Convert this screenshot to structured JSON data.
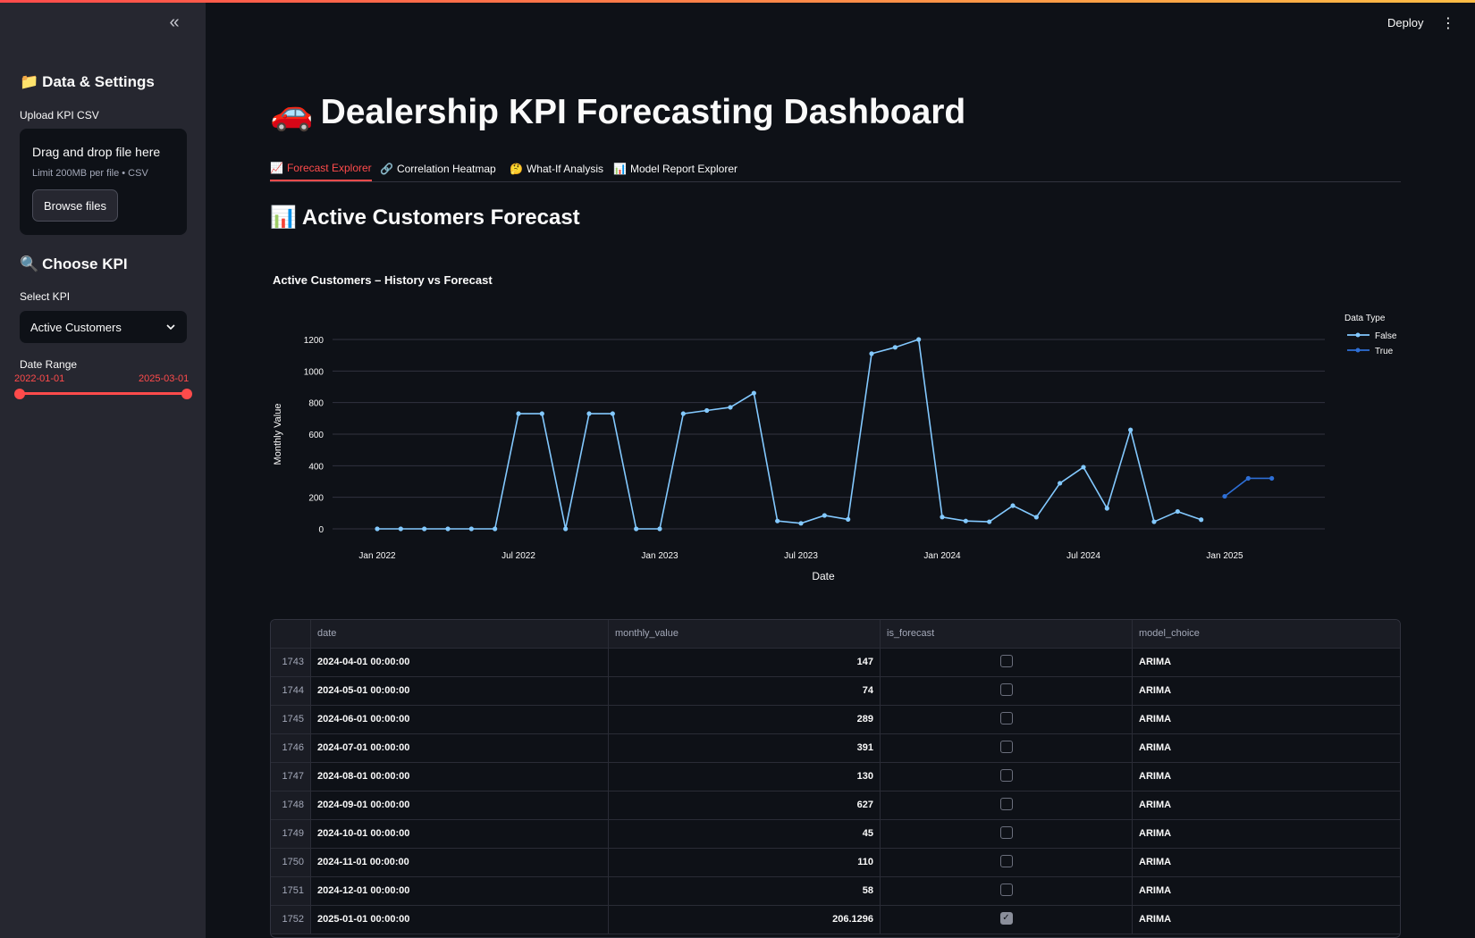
{
  "sidebar": {
    "collapse_icon": "chevrons-left-icon",
    "data_settings_heading": "Data & Settings",
    "data_settings_icon": "📁",
    "upload_label": "Upload KPI CSV",
    "upload_drag_text": "Drag and drop file here",
    "upload_limit_text": "Limit 200MB per file • CSV",
    "browse_button": "Browse files",
    "choose_kpi_heading": "Choose KPI",
    "choose_kpi_icon": "🔍",
    "select_kpi_label": "Select KPI",
    "selected_kpi": "Active Customers",
    "date_range_label": "Date Range",
    "date_range_start": "2022-01-01",
    "date_range_end": "2025-03-01"
  },
  "header": {
    "deploy_label": "Deploy",
    "menu_icon": "vertical-dots-icon"
  },
  "main": {
    "title": "Dealership KPI Forecasting Dashboard",
    "title_icon": "🚗",
    "tabs": [
      {
        "icon": "📈",
        "label": "Forecast Explorer",
        "active": true
      },
      {
        "icon": "🔗",
        "label": "Correlation Heatmap",
        "active": false
      },
      {
        "icon": "🤔",
        "label": "What-If Analysis",
        "active": false
      },
      {
        "icon": "📊",
        "label": "Model Report Explorer",
        "active": false
      }
    ],
    "section_title": "Active Customers Forecast",
    "section_icon": "📊",
    "chart_title": "Active Customers  – History vs Forecast"
  },
  "chart_data": {
    "type": "line",
    "title": "Active Customers  – History vs Forecast",
    "xlabel": "Date",
    "ylabel": "Monthly Value",
    "ylim": [
      0,
      1200
    ],
    "yticks": [
      0,
      200,
      400,
      600,
      800,
      1000,
      1200
    ],
    "xticks": [
      "Jan 2022",
      "Jul 2022",
      "Jan 2023",
      "Jul 2023",
      "Jan 2024",
      "Jul 2024",
      "Jan 2025"
    ],
    "x_start": "2022-01",
    "x_end": "2025-03",
    "grid": true,
    "legend": {
      "title": "Data Type",
      "placement": "top-right"
    },
    "colors": {
      "False": "#83c9ff",
      "True": "#2e6fd6"
    },
    "series": [
      {
        "name": "False",
        "x": [
          "2022-01",
          "2022-02",
          "2022-03",
          "2022-04",
          "2022-05",
          "2022-06",
          "2022-07",
          "2022-08",
          "2022-09",
          "2022-10",
          "2022-11",
          "2022-12",
          "2023-01",
          "2023-02",
          "2023-03",
          "2023-04",
          "2023-05",
          "2023-06",
          "2023-07",
          "2023-08",
          "2023-09",
          "2023-10",
          "2023-11",
          "2023-12",
          "2024-01",
          "2024-02",
          "2024-03",
          "2024-04",
          "2024-05",
          "2024-06",
          "2024-07",
          "2024-08",
          "2024-09",
          "2024-10",
          "2024-11",
          "2024-12"
        ],
        "values": [
          0,
          0,
          0,
          0,
          0,
          0,
          730,
          730,
          0,
          730,
          730,
          0,
          0,
          730,
          750,
          770,
          860,
          50,
          35,
          85,
          60,
          1110,
          1150,
          1200,
          75,
          50,
          45,
          147,
          74,
          289,
          391,
          130,
          627,
          45,
          110,
          58
        ]
      },
      {
        "name": "True",
        "x": [
          "2025-01",
          "2025-02",
          "2025-03"
        ],
        "values": [
          206.1296,
          320,
          320
        ]
      }
    ]
  },
  "table": {
    "columns": [
      "",
      "date",
      "monthly_value",
      "is_forecast",
      "model_choice"
    ],
    "rows": [
      {
        "index": "1743",
        "date": "2024-04-01 00:00:00",
        "monthly_value": "147",
        "is_forecast": false,
        "model_choice": "ARIMA"
      },
      {
        "index": "1744",
        "date": "2024-05-01 00:00:00",
        "monthly_value": "74",
        "is_forecast": false,
        "model_choice": "ARIMA"
      },
      {
        "index": "1745",
        "date": "2024-06-01 00:00:00",
        "monthly_value": "289",
        "is_forecast": false,
        "model_choice": "ARIMA"
      },
      {
        "index": "1746",
        "date": "2024-07-01 00:00:00",
        "monthly_value": "391",
        "is_forecast": false,
        "model_choice": "ARIMA"
      },
      {
        "index": "1747",
        "date": "2024-08-01 00:00:00",
        "monthly_value": "130",
        "is_forecast": false,
        "model_choice": "ARIMA"
      },
      {
        "index": "1748",
        "date": "2024-09-01 00:00:00",
        "monthly_value": "627",
        "is_forecast": false,
        "model_choice": "ARIMA"
      },
      {
        "index": "1749",
        "date": "2024-10-01 00:00:00",
        "monthly_value": "45",
        "is_forecast": false,
        "model_choice": "ARIMA"
      },
      {
        "index": "1750",
        "date": "2024-11-01 00:00:00",
        "monthly_value": "110",
        "is_forecast": false,
        "model_choice": "ARIMA"
      },
      {
        "index": "1751",
        "date": "2024-12-01 00:00:00",
        "monthly_value": "58",
        "is_forecast": false,
        "model_choice": "ARIMA"
      },
      {
        "index": "1752",
        "date": "2025-01-01 00:00:00",
        "monthly_value": "206.1296",
        "is_forecast": true,
        "model_choice": "ARIMA"
      }
    ]
  }
}
